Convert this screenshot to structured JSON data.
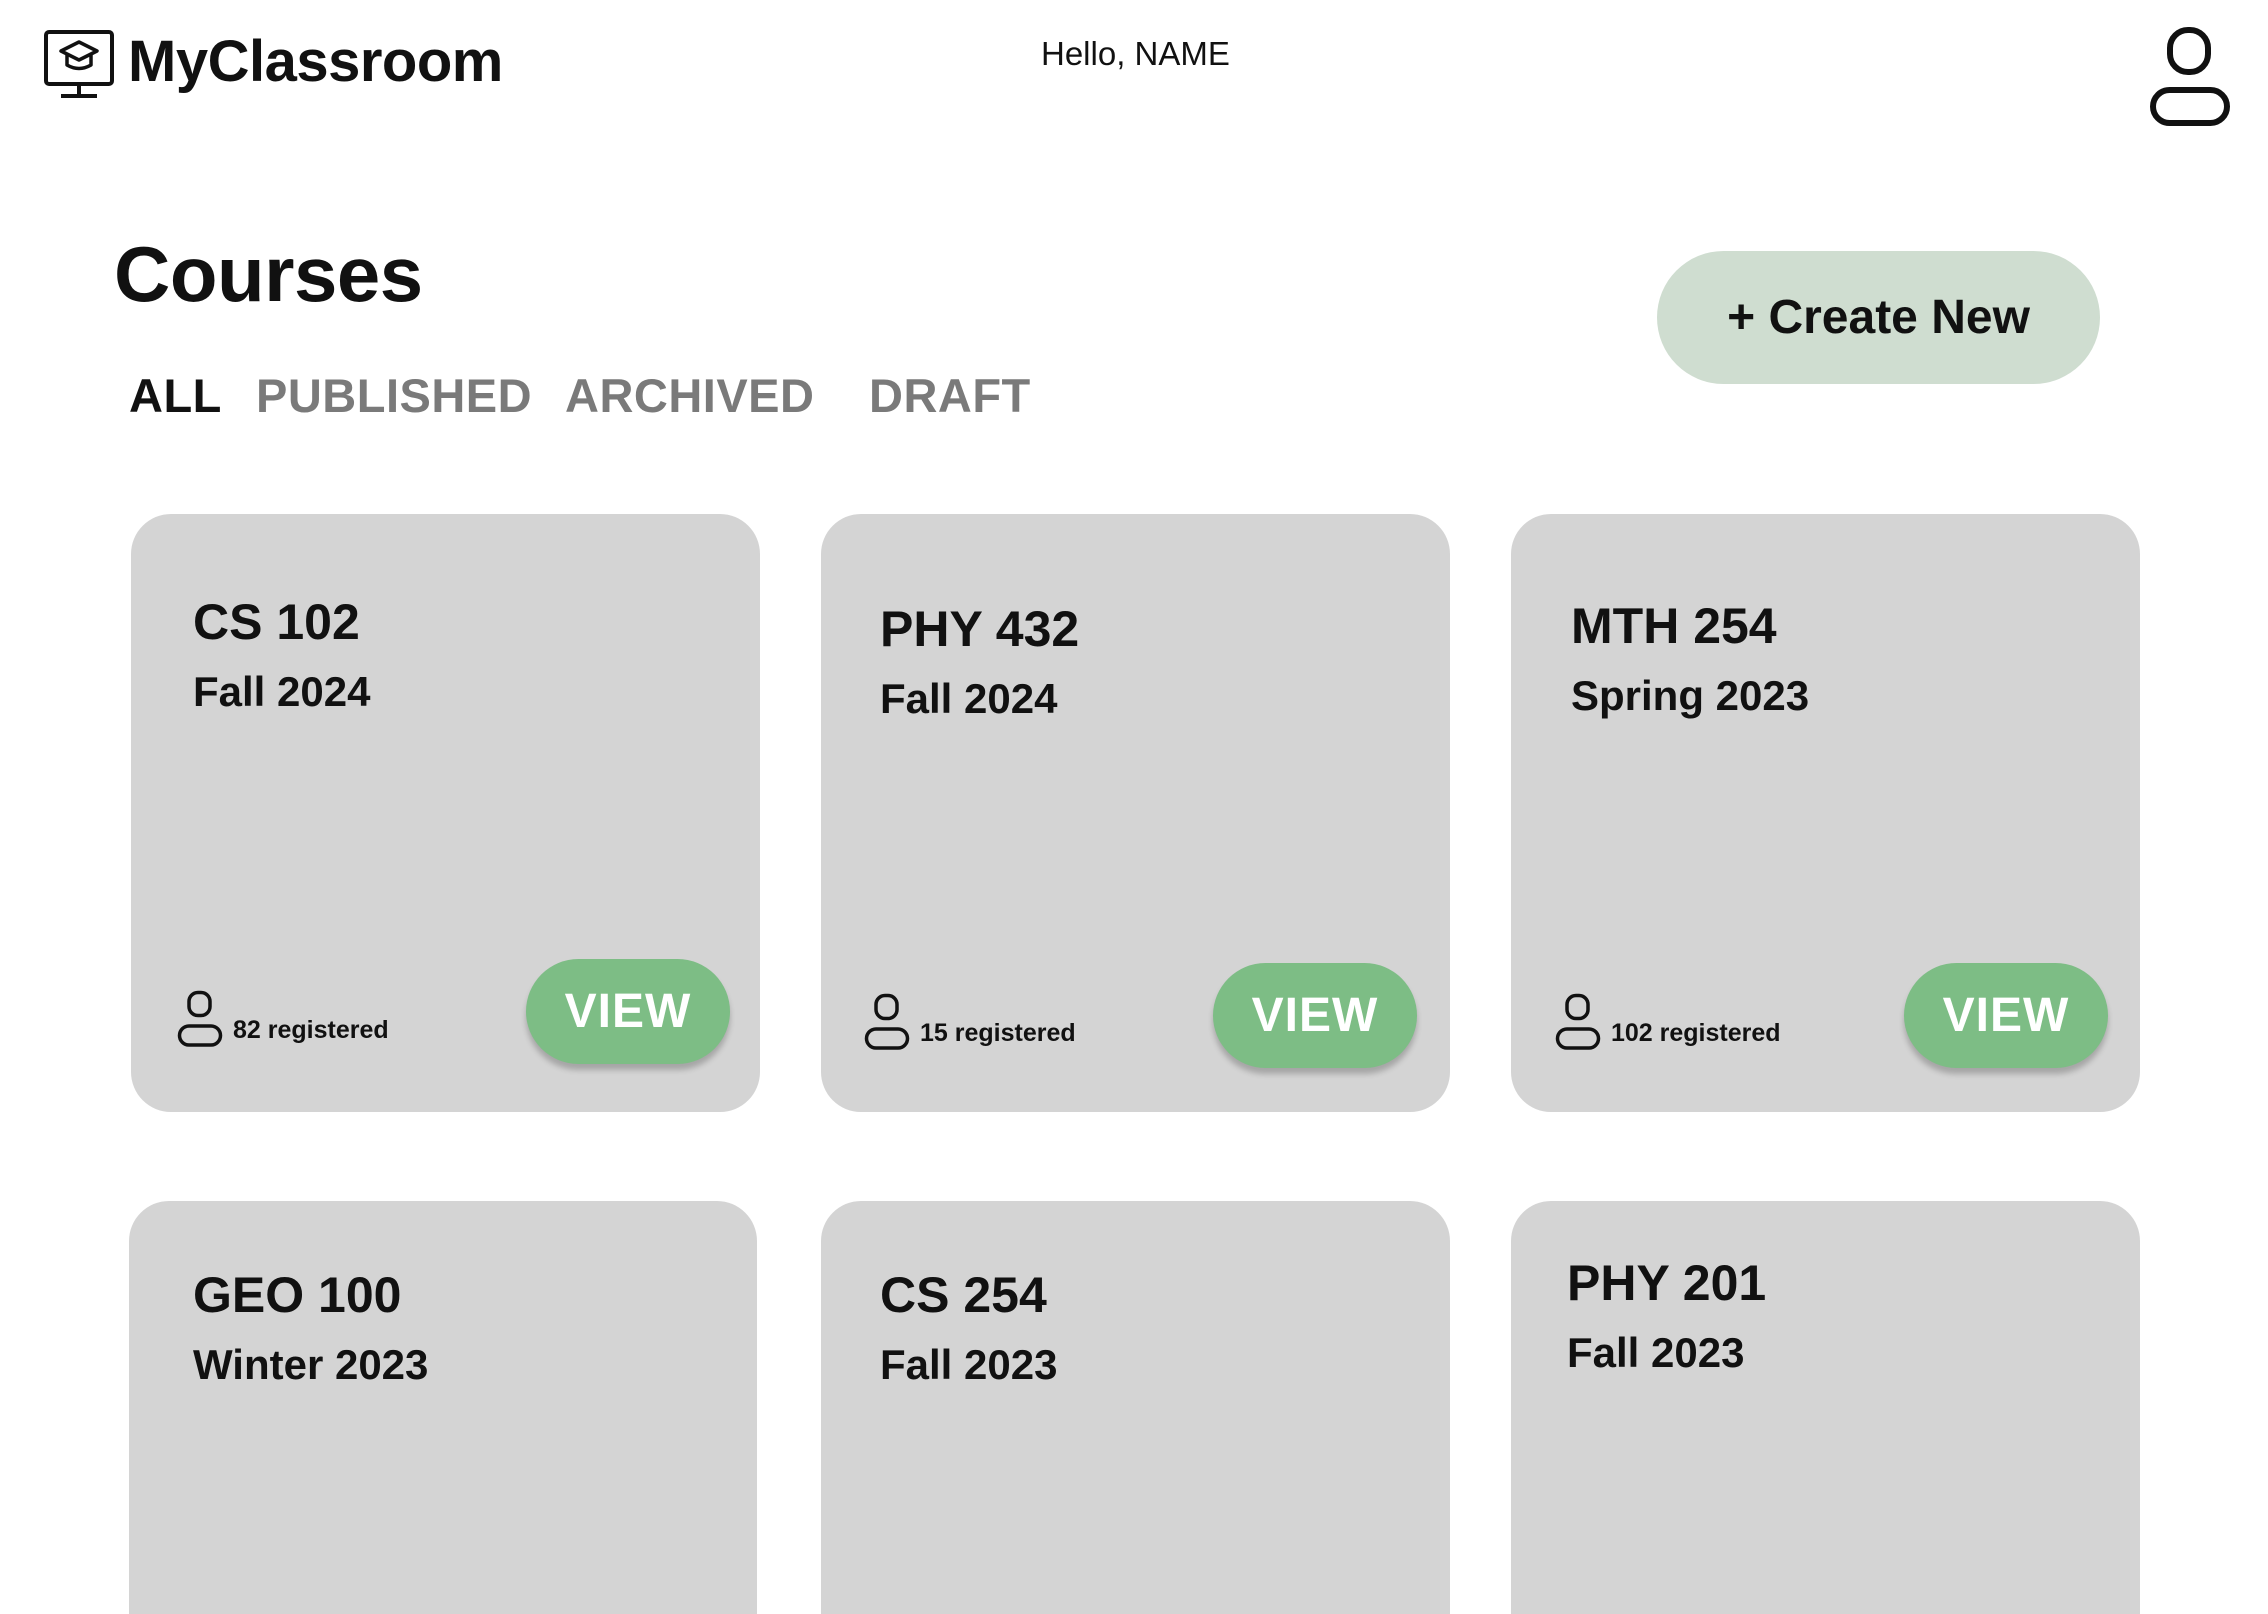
{
  "header": {
    "app_name": "MyClassroom",
    "greeting": "Hello, NAME"
  },
  "main": {
    "title": "Courses",
    "create_button": "+ Create New",
    "tabs": [
      {
        "label": "ALL",
        "active": true
      },
      {
        "label": "PUBLISHED",
        "active": false
      },
      {
        "label": "ARCHIVED",
        "active": false
      },
      {
        "label": "DRAFT",
        "active": false
      }
    ]
  },
  "courses": [
    {
      "code": "CS 102",
      "term": "Fall 2024",
      "registered": "82 registered",
      "action": "VIEW"
    },
    {
      "code": "PHY 432",
      "term": "Fall 2024",
      "registered": "15 registered",
      "action": "VIEW"
    },
    {
      "code": "MTH 254",
      "term": "Spring 2023",
      "registered": "102 registered",
      "action": "VIEW"
    },
    {
      "code": "GEO 100",
      "term": "Winter 2023"
    },
    {
      "code": "CS 254",
      "term": "Fall 2023"
    },
    {
      "code": "PHY 201",
      "term": "Fall 2023"
    }
  ],
  "colors": {
    "card_background": "#d4d4d4",
    "view_button": "#7dbd85",
    "create_button": "#cfddd0",
    "inactive_tab": "#7a7a7a"
  },
  "icons": {
    "logo": "classroom-monitor-icon",
    "avatar": "user-icon",
    "registered": "user-icon"
  }
}
